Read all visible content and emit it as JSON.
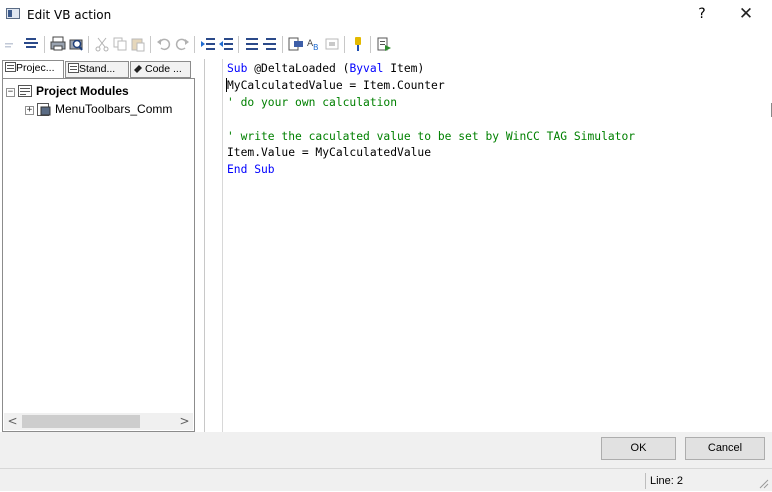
{
  "window": {
    "title": "Edit VB action",
    "help_label": "?",
    "close_label": "✕"
  },
  "toolbar": {
    "icons": [
      "indent-marker-icon",
      "align-icon",
      "print-icon",
      "print-preview-icon",
      "cut-icon",
      "copy-icon",
      "paste-icon",
      "undo-icon",
      "redo-icon",
      "indent-icon",
      "outdent-icon",
      "comment-icon",
      "uncomment-icon",
      "find-icon",
      "replace-icon",
      "goto-icon",
      "syntax-check-icon",
      "references-icon"
    ]
  },
  "left_panel": {
    "tabs": [
      "Projec...",
      "Stand...",
      "Code ..."
    ],
    "tree": {
      "root_label": "Project Modules",
      "child_label": "MenuToolbars_Comm"
    },
    "scroll_left": "<",
    "scroll_right": ">"
  },
  "editor": {
    "lines": [
      [
        {
          "t": "Sub ",
          "c": "kw"
        },
        {
          "t": "@DeltaLoaded (",
          "c": "tx"
        },
        {
          "t": "Byval",
          "c": "kw"
        },
        {
          "t": " Item)",
          "c": "tx"
        }
      ],
      [
        {
          "t": "MyCalculatedValue = Item.Counter",
          "c": "tx"
        }
      ],
      [
        {
          "t": "' do your own calculation",
          "c": "cm"
        }
      ],
      [
        {
          "t": "",
          "c": "tx"
        }
      ],
      [
        {
          "t": "' write the caculated value to be set by WinCC TAG Simulator",
          "c": "cm"
        }
      ],
      [
        {
          "t": "Item.Value = MyCalculatedValue",
          "c": "tx"
        }
      ],
      [
        {
          "t": "End Sub",
          "c": "kw"
        }
      ]
    ]
  },
  "buttons": {
    "ok_label": "OK",
    "cancel_label": "Cancel"
  },
  "status": {
    "line_text": "Line: 2"
  },
  "colors": {
    "keyword": "#0000ff",
    "comment": "#008000",
    "text": "#000000"
  }
}
